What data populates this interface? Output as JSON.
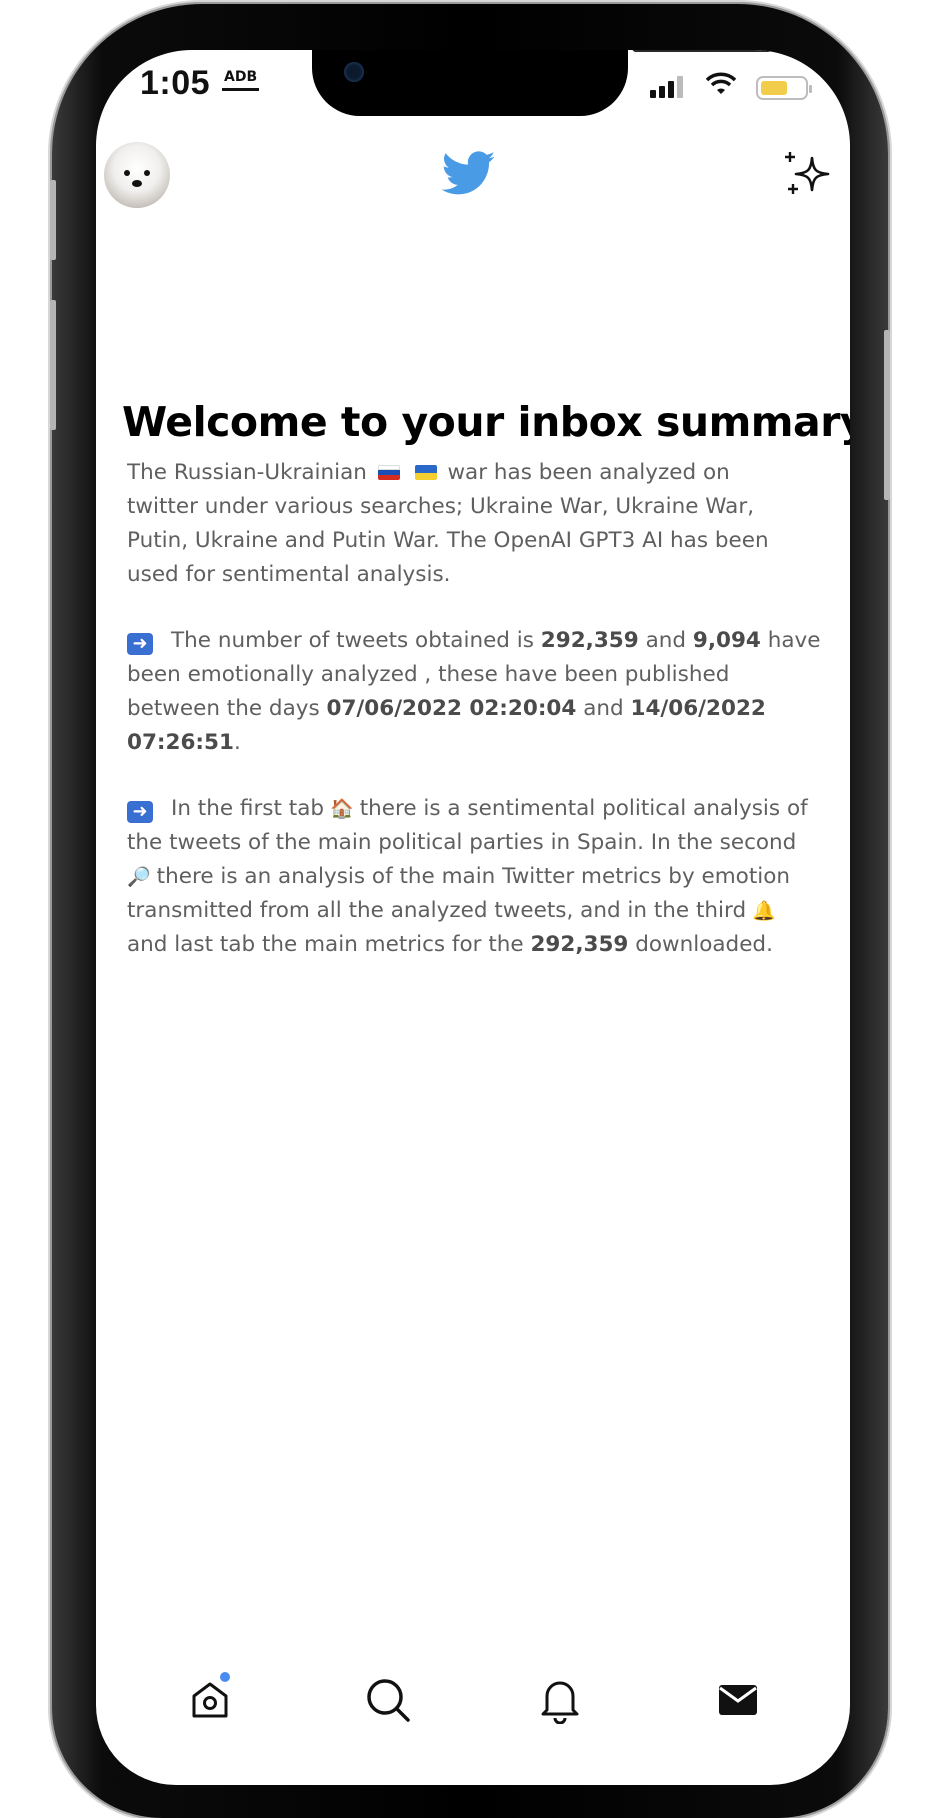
{
  "status_bar": {
    "time": "1:05",
    "app_icon": "ADB",
    "battery_color": "#f1cd4b"
  },
  "header": {
    "logo_color": "#4a9be6",
    "avatar": "samoyed-dog-avatar",
    "sparkle": "sparkle-icon"
  },
  "content": {
    "title": "Welcome to your inbox summary!",
    "p1": {
      "a": "The Russian-Ukrainian",
      "b": "war has been analyzed on",
      "c": "twitter under various searches; Ukraine War, Ukraine War,",
      "d": "Putin, Ukraine and Putin War. The OpenAI GPT3 AI has been",
      "e": "used for sentimental analysis."
    },
    "p2": {
      "a": "The number of tweets obtained is",
      "tweets_total": "292,359",
      "and1": "and",
      "tweets_analyzed": "9,094",
      "b": "have",
      "c": "been emotionally analyzed , these have been published",
      "d": "between the days",
      "date_start": "07/06/2022 02:20:04",
      "and2": "and",
      "date_end_day": "14/06/2022",
      "date_end_time": "07:26:51",
      "period": "."
    },
    "p3": {
      "a": "In the first tab",
      "b": "there is a sentimental political analysis of",
      "c": "the tweets of the main political parties in Spain. In the second",
      "d": "there is an analysis of the main Twitter metrics by emotion",
      "e": "transmitted from all the analyzed tweets, and in the third",
      "f": "and last tab the main metrics for the",
      "total": "292,359",
      "g": "downloaded."
    }
  },
  "tabbar": {
    "items": [
      "home-icon",
      "search-icon",
      "bell-icon",
      "mail-icon"
    ],
    "notification_dot_color": "#4a8df0"
  }
}
